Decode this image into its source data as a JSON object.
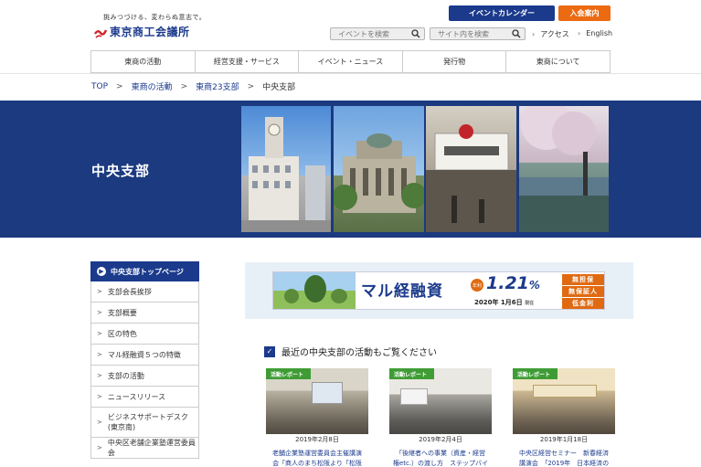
{
  "header": {
    "tagline": "挑みつづける、変わらぬ意志で。",
    "brand": "東京商工会議所",
    "event_calendar": "イベントカレンダー",
    "join": "入会案内",
    "event_search_placeholder": "イベントを検索",
    "site_search_placeholder": "サイト内を検索",
    "access": "アクセス",
    "english": "English"
  },
  "nav": {
    "items": [
      {
        "label": "東商の活動"
      },
      {
        "label": "経営支援・サービス"
      },
      {
        "label": "イベント・ニュース"
      },
      {
        "label": "発行物"
      },
      {
        "label": "東商について"
      }
    ]
  },
  "breadcrumb": {
    "top": "TOP",
    "activities": "東商の活動",
    "branches": "東商23支部",
    "current": "中央支部"
  },
  "hero": {
    "title": "中央支部"
  },
  "sidebar": {
    "head": "中央支部トップページ",
    "items": [
      {
        "label": "支部会長挨拶"
      },
      {
        "label": "支部概要"
      },
      {
        "label": "区の特色"
      },
      {
        "label": "マル経融資５つの特徴"
      },
      {
        "label": "支部の活動"
      },
      {
        "label": "ニュースリリース"
      },
      {
        "label": "ビジネスサポートデスク",
        "label2": "(東京南)"
      },
      {
        "label": "中央区老舗企業塾運営委員会"
      }
    ]
  },
  "banner": {
    "title": "マル経融資",
    "badge": "年利",
    "rate": "1.21",
    "rate_unit": "%",
    "date": "2020年 1月6日",
    "date_suffix": "現在",
    "tags": [
      "無担保",
      "無保証人",
      "低金利"
    ]
  },
  "section": {
    "title": "最近の中央支部の活動もご覧ください"
  },
  "cards": [
    {
      "badge": "活動レポート",
      "date": "2019年2月8日",
      "line1": "老舗企業塾運営委員会主催講演",
      "line2": "会「商人のまち松阪より「松阪"
    },
    {
      "badge": "活動レポート",
      "date": "2019年2月4日",
      "line1": "「後継者への事業（資産・経営",
      "line2": "権etc.）の渡し方　ステップバイ"
    },
    {
      "badge": "活動レポート",
      "date": "2019年1月18日",
      "line1": "中央区経営セミナー　新春経済",
      "line2": "講演会　「2019年　日本経済の"
    }
  ],
  "colors": {
    "brand_blue": "#1b3a8c",
    "hero_blue": "#1b3a7f",
    "orange": "#ec6a12",
    "badge_green": "#3f9c35"
  }
}
